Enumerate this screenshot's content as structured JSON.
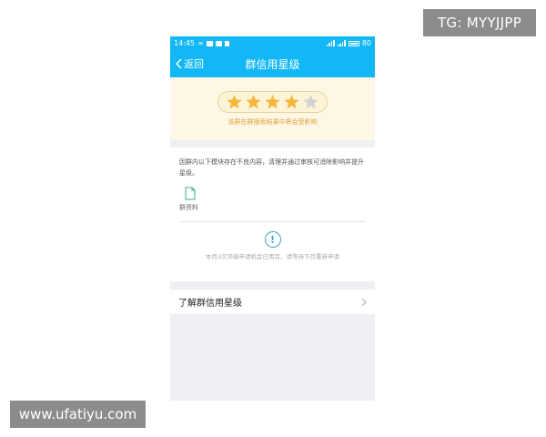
{
  "watermarks": {
    "top_right": "TG: MYYJJPP",
    "bottom_left": "www.ufatiyu.com"
  },
  "status_bar": {
    "time": "14:45",
    "battery": "80",
    "left_icons": [
      "infinity-icon",
      "mail-icon",
      "image-icon",
      "sim-icon"
    ],
    "right_icons": [
      "signal-icon",
      "wifi-bars-icon",
      "battery-icon"
    ]
  },
  "nav": {
    "back_label": "返回",
    "title": "群信用星级"
  },
  "rating": {
    "stars_filled": 4,
    "stars_total": 5,
    "caption": "该群在群搜索结果中将会受影响",
    "star_color": "#f5b73b",
    "star_empty_color": "#d2d2d2"
  },
  "content": {
    "notice": "因群内以下模块存在不良内容，清理并通过审核可消除影响并提升星级。",
    "module_label": "群资料",
    "warning_text": "本月3次评级申请机会已用完，请等待下月重新申请"
  },
  "learn_more": {
    "label": "了解群信用星级"
  },
  "colors": {
    "accent": "#12b7f5",
    "rating_bg": "#fef7e5",
    "warn": "#3aa6c4"
  }
}
